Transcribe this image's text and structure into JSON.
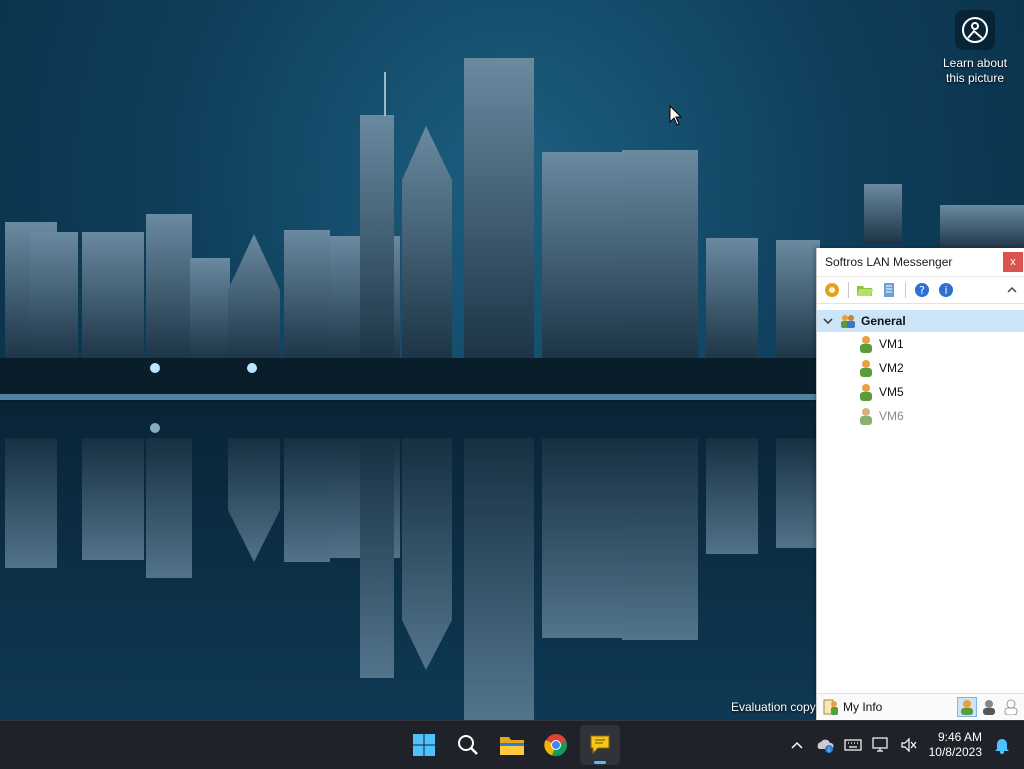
{
  "desktop": {
    "widget_label": "Learn about this picture",
    "widget_icon": "camera-icon",
    "evaluation_text": "Evaluation copy"
  },
  "messenger": {
    "title": "Softros LAN Messenger",
    "close_label": "x",
    "toolbar_icons": [
      "settings-icon",
      "open-folder-icon",
      "history-icon",
      "help-icon",
      "info-icon"
    ],
    "group": {
      "label": "General"
    },
    "users": [
      {
        "label": "VM1",
        "online": true
      },
      {
        "label": "VM2",
        "online": true
      },
      {
        "label": "VM5",
        "online": true
      },
      {
        "label": "VM6",
        "online": false
      }
    ],
    "statusbar": {
      "myinfo_label": "My Info"
    }
  },
  "taskbar": {
    "apps": [
      "windows-start-icon",
      "search-icon",
      "file-explorer-icon",
      "chrome-icon",
      "softros-messenger-icon"
    ],
    "time": "9:46 AM",
    "date": "10/8/2023"
  },
  "colors": {
    "selection": "#cce4f7",
    "close": "#d9534f",
    "taskbar": "#1f2228",
    "accent": "#60b4ff"
  }
}
